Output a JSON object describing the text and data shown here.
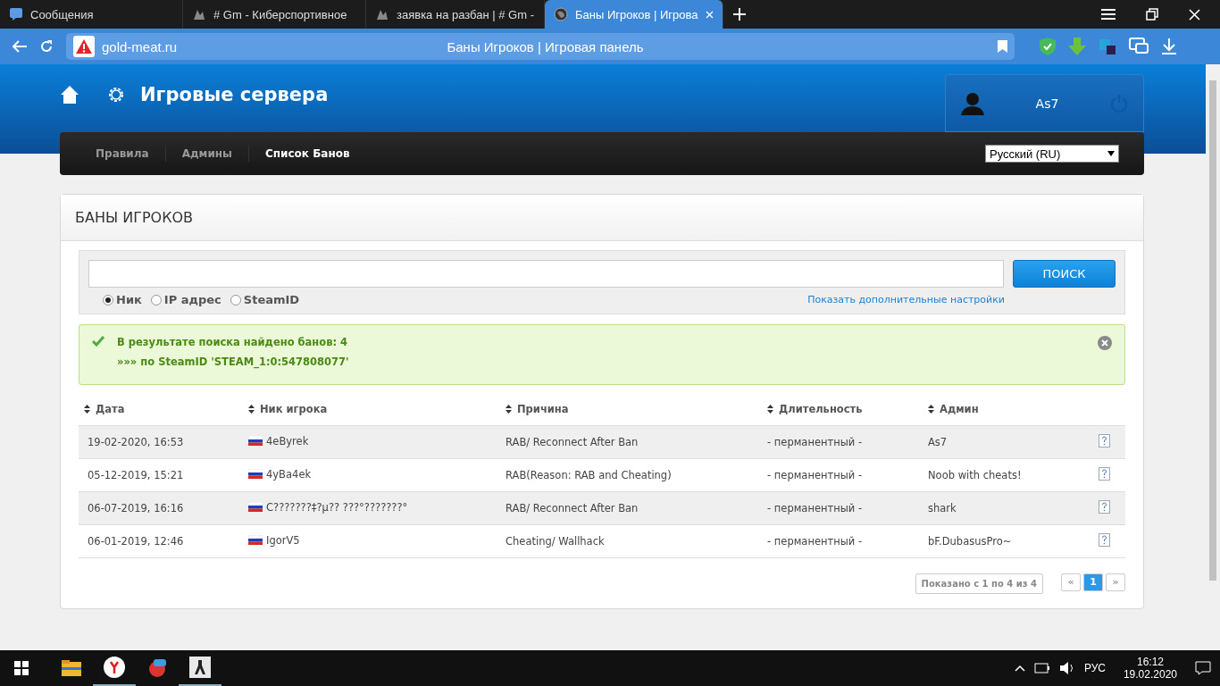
{
  "browser": {
    "tabs": [
      {
        "title": "Сообщения",
        "selected": false,
        "kind": "messages"
      },
      {
        "title": "# Gm - Киберспортивное",
        "selected": false,
        "kind": "site"
      },
      {
        "title": "заявка на разбан | # Gm -",
        "selected": false,
        "kind": "site"
      },
      {
        "title": "Баны Игроков | Игрова",
        "selected": true,
        "kind": "globe"
      }
    ],
    "url": "gold-meat.ru",
    "page_title": "Баны Игроков | Игровая панель"
  },
  "header": {
    "title": "Игровые сервера",
    "user": "As7"
  },
  "nav": {
    "items": [
      {
        "label": "Правила",
        "selected": false
      },
      {
        "label": "Админы",
        "selected": false
      },
      {
        "label": "Список Банов",
        "selected": true
      }
    ],
    "language": "Русский (RU)"
  },
  "panel": {
    "title": "БАНЫ ИГРОКОВ",
    "search": {
      "button": "ПОИСК",
      "options": [
        {
          "label": "Ник",
          "selected": true
        },
        {
          "label": "IP адрес",
          "selected": false
        },
        {
          "label": "SteamID",
          "selected": false
        }
      ],
      "more_link": "Показать дополнительные настройки"
    },
    "alert": {
      "line1": "В результате поиска найдено банов: 4",
      "line2": "»»» по SteamID 'STEAM_1:0:547808077'"
    },
    "table": {
      "columns": [
        "Дата",
        "Ник игрока",
        "Причина",
        "Длительность",
        "Админ"
      ],
      "rows": [
        {
          "date": "19-02-2020, 16:53",
          "nick": "4eByrek",
          "reason": "RAB/ Reconnect After Ban",
          "duration": "- перманентный -",
          "admin": "As7"
        },
        {
          "date": "05-12-2019, 15:21",
          "nick": "4yBa4ek",
          "reason": "RAB(Reason: RAB and Cheating)",
          "duration": "- перманентный -",
          "admin": "Noob with cheats!"
        },
        {
          "date": "06-07-2019, 16:16",
          "nick": "C???????‡?µ?? ???°???????°",
          "reason": "RAB/ Reconnect After Ban",
          "duration": "- перманентный -",
          "admin": "shark"
        },
        {
          "date": "06-01-2019, 12:46",
          "nick": "IgorV5",
          "reason": "Cheating/ Wallhack",
          "duration": "- перманентный -",
          "admin": "bF.DubasusPro~"
        }
      ]
    },
    "pagination": {
      "summary": "Показано с 1 по 4 из 4",
      "prev": "«",
      "next": "»",
      "pages": [
        {
          "label": "1",
          "selected": true
        }
      ]
    }
  },
  "taskbar": {
    "language": "РУС",
    "time": "16:12",
    "date": "19.02.2020"
  }
}
